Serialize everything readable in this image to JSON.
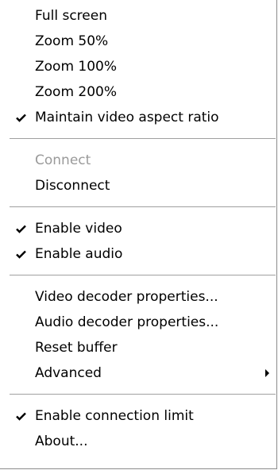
{
  "menu": {
    "groups": [
      [
        {
          "label": "Full screen",
          "checked": false,
          "enabled": true,
          "submenu": false
        },
        {
          "label": "Zoom 50%",
          "checked": false,
          "enabled": true,
          "submenu": false
        },
        {
          "label": "Zoom 100%",
          "checked": false,
          "enabled": true,
          "submenu": false
        },
        {
          "label": "Zoom 200%",
          "checked": false,
          "enabled": true,
          "submenu": false
        },
        {
          "label": "Maintain video aspect ratio",
          "checked": true,
          "enabled": true,
          "submenu": false
        }
      ],
      [
        {
          "label": "Connect",
          "checked": false,
          "enabled": false,
          "submenu": false
        },
        {
          "label": "Disconnect",
          "checked": false,
          "enabled": true,
          "submenu": false
        }
      ],
      [
        {
          "label": "Enable video",
          "checked": true,
          "enabled": true,
          "submenu": false
        },
        {
          "label": "Enable audio",
          "checked": true,
          "enabled": true,
          "submenu": false
        }
      ],
      [
        {
          "label": "Video decoder properties...",
          "checked": false,
          "enabled": true,
          "submenu": false
        },
        {
          "label": "Audio decoder properties...",
          "checked": false,
          "enabled": true,
          "submenu": false
        },
        {
          "label": "Reset buffer",
          "checked": false,
          "enabled": true,
          "submenu": false
        },
        {
          "label": "Advanced",
          "checked": false,
          "enabled": true,
          "submenu": true
        }
      ],
      [
        {
          "label": "Enable connection limit",
          "checked": true,
          "enabled": true,
          "submenu": false
        },
        {
          "label": "About...",
          "checked": false,
          "enabled": true,
          "submenu": false
        }
      ]
    ],
    "icons": {
      "check": "checkmark-icon",
      "submenu": "submenu-arrow-icon"
    },
    "colors": {
      "text": "#000000",
      "disabled_text": "#9a9a9a",
      "separator": "#a0a0a0",
      "background": "#ffffff"
    }
  }
}
